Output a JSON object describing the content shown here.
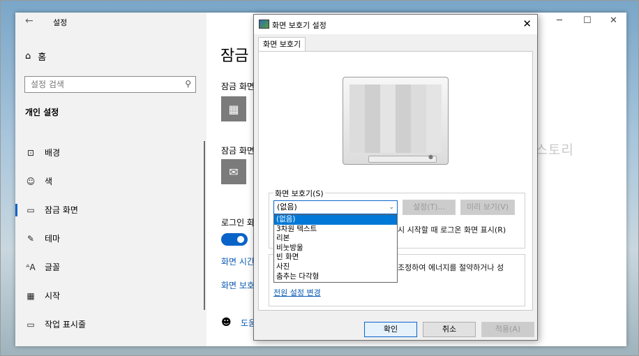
{
  "settings": {
    "title": "설정",
    "back_icon": "←",
    "home_label": "홈",
    "search_placeholder": "설정 검색",
    "section_title": "개인 설정",
    "nav": [
      {
        "icon": "image-icon",
        "glyph": "⊡",
        "label": "배경"
      },
      {
        "icon": "palette-icon",
        "glyph": "☺",
        "label": "색"
      },
      {
        "icon": "lock-screen-icon",
        "glyph": "▭",
        "label": "잠금 화면",
        "active": true
      },
      {
        "icon": "theme-icon",
        "glyph": "✎",
        "label": "테마"
      },
      {
        "icon": "font-icon",
        "glyph": "ᴬA",
        "label": "글꼴"
      },
      {
        "icon": "start-icon",
        "glyph": "▦",
        "label": "시작"
      },
      {
        "icon": "taskbar-icon",
        "glyph": "▭",
        "label": "작업 표시줄"
      }
    ],
    "window_controls": {
      "minimize": "─",
      "maximize": "☐",
      "close": "✕"
    },
    "main": {
      "heading": "잠금",
      "label1": "잠금 화면",
      "label2": "잠금 화면",
      "label3": "로그인 화",
      "link1": "화면 시간",
      "link2": "화면 보호",
      "help_link": "도움"
    }
  },
  "dialog": {
    "title": "화면 보호기 설정",
    "close": "✕",
    "tab": "화면 보호기",
    "watermark": "해피파파 티스토리",
    "group_label": "화면 보호기(S)",
    "combo_value": "(없음)",
    "settings_button": "설정(T)...",
    "preview_button": "미리 보기(V)",
    "resume_text": "시 시작할 때 로그온 화면 표시(R)",
    "power_text": "조정하여 에너지를 절약하거나 성",
    "power_link": "전원 설정 변경",
    "options": [
      "(없음)",
      "3차원 텍스트",
      "리본",
      "비눗방울",
      "빈 화면",
      "사진",
      "춤추는 다각형"
    ],
    "ok": "확인",
    "cancel": "취소",
    "apply": "적용(A)"
  }
}
